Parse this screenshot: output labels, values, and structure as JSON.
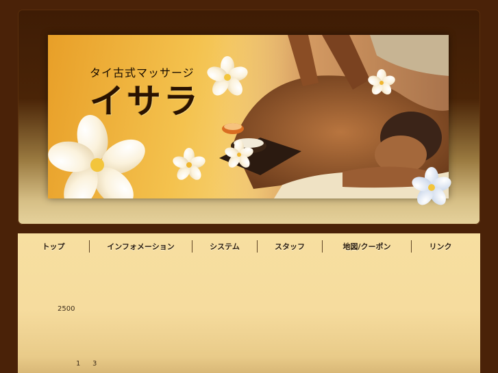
{
  "header": {
    "subtitle": "タイ古式マッサージ",
    "title": "イサラ"
  },
  "nav": {
    "items": [
      {
        "label": "トップ"
      },
      {
        "label": "インフォメーション"
      },
      {
        "label": "システム"
      },
      {
        "label": "スタッフ"
      },
      {
        "label": "地図/クーポン"
      },
      {
        "label": "リンク"
      }
    ]
  },
  "content": {
    "price": "2500",
    "numbers": [
      "1",
      "3"
    ]
  },
  "colors": {
    "background": "#4a2208",
    "content_background": "#f7dfa0",
    "banner_orange": "#e89f28",
    "nav_text": "#2b1d0e"
  },
  "icons": [
    "plumeria-flower-icon"
  ]
}
